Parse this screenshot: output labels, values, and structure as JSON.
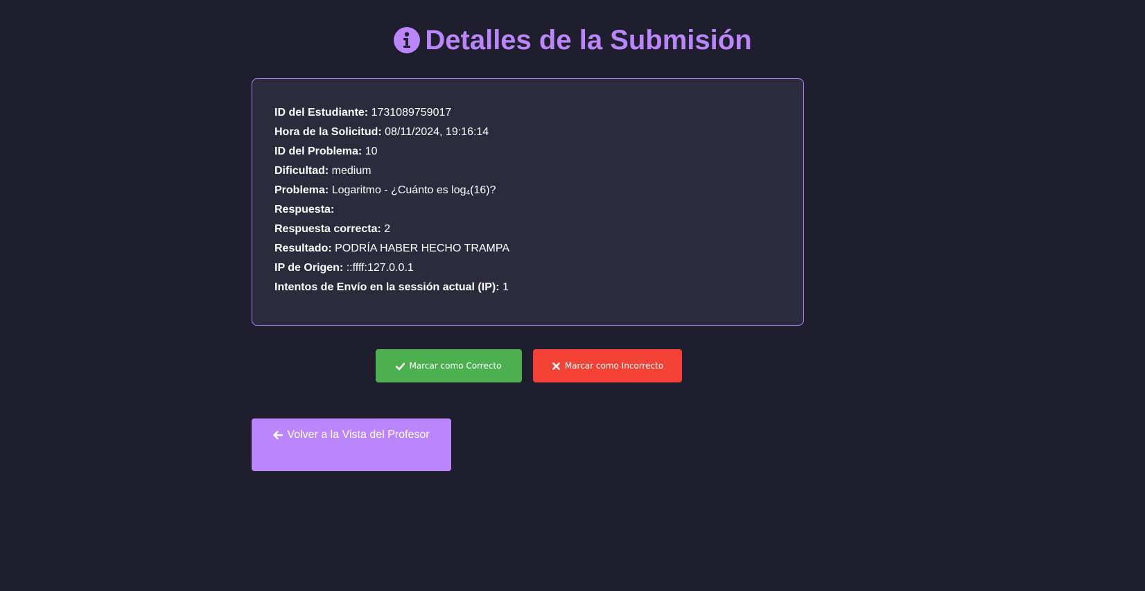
{
  "header": {
    "title": "Detalles de la Submisión",
    "icon": "info-circle-icon",
    "accent_color": "#bb86fc"
  },
  "details": [
    {
      "label": "ID del Estudiante:",
      "value": "1731089759017"
    },
    {
      "label": "Hora de la Solicitud:",
      "value": "08/11/2024, 19:16:14"
    },
    {
      "label": "ID del Problema:",
      "value": "10"
    },
    {
      "label": "Dificultad:",
      "value": "medium"
    },
    {
      "label": "Problema:",
      "value_prefix": "Logaritmo - ¿Cuánto es log",
      "value_sub": "4",
      "value_suffix": "(16)?"
    },
    {
      "label": "Respuesta:",
      "value": ""
    },
    {
      "label": "Respuesta correcta:",
      "value": "2"
    },
    {
      "label": "Resultado:",
      "value": "PODRÍA HABER HECHO TRAMPA"
    },
    {
      "label": "IP de Origen:",
      "value": "::ffff:127.0.0.1"
    },
    {
      "label": "Intentos de Envío en la sessión actual (IP):",
      "value": "1"
    }
  ],
  "actions": {
    "correct_label": "Marcar como Correcto",
    "correct_icon": "check-icon",
    "correct_color": "#4caf50",
    "incorrect_label": "Marcar como Incorrecto",
    "incorrect_icon": "times-icon",
    "incorrect_color": "#f44336"
  },
  "back": {
    "label": "Volver a la Vista del Profesor",
    "icon": "arrow-left-icon",
    "color": "#bb86fc"
  }
}
